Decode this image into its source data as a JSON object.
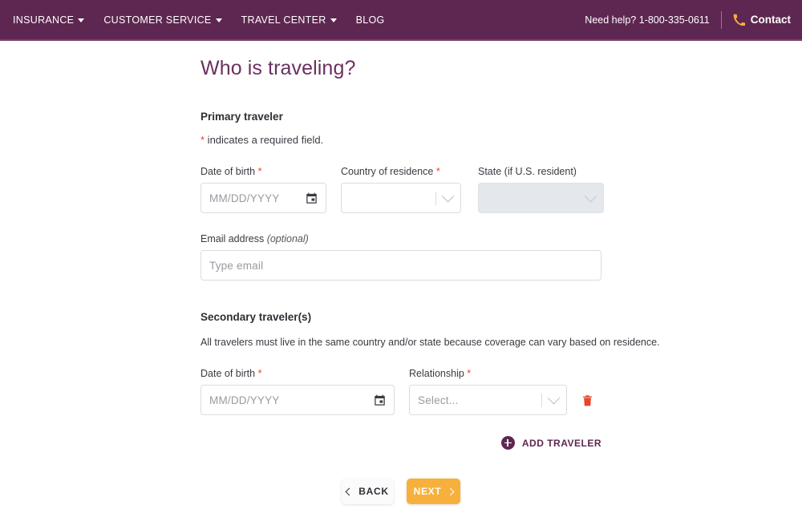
{
  "header": {
    "nav": [
      {
        "label": "INSURANCE",
        "has_caret": true,
        "icon": "chevron-down-icon"
      },
      {
        "label": "CUSTOMER SERVICE",
        "has_caret": true,
        "icon": "chevron-down-icon"
      },
      {
        "label": "TRAVEL CENTER",
        "has_caret": true,
        "icon": "chevron-down-icon"
      },
      {
        "label": "BLOG",
        "has_caret": false,
        "icon": ""
      }
    ],
    "help_text": "Need help? 1-800-335-0611",
    "contact_label": "Contact",
    "phone_icon": "phone-icon",
    "bg_color": "#5e2751",
    "accent_color": "#f7b03c"
  },
  "main": {
    "title": "Who is traveling?",
    "title_color": "#6b3060",
    "primary": {
      "heading": "Primary traveler",
      "required_note_asterisk": "*",
      "required_note": " indicates a required field.",
      "dob": {
        "label": "Date of birth",
        "required": "*",
        "placeholder": "MM/DD/YYYY",
        "value": "",
        "icon": "calendar-icon"
      },
      "country": {
        "label": "Country of residence",
        "required": "*",
        "placeholder": "",
        "value": "",
        "icon": "chevron-down-icon"
      },
      "state": {
        "label": "State (if U.S. resident)",
        "required": "",
        "placeholder": "",
        "value": "",
        "disabled": true,
        "icon": "chevron-down-icon"
      },
      "email": {
        "label": "Email address ",
        "optional_label": "(optional)",
        "placeholder": "Type email",
        "value": ""
      }
    },
    "secondary": {
      "heading": "Secondary traveler(s)",
      "description": "All travelers must live in the same country and/or state because coverage can vary based on residence.",
      "dob": {
        "label": "Date of birth",
        "required": "*",
        "placeholder": "MM/DD/YYYY",
        "value": "",
        "icon": "calendar-icon"
      },
      "relationship": {
        "label": "Relationship",
        "required": "*",
        "placeholder": "Select...",
        "value": "",
        "icon": "chevron-down-icon"
      },
      "delete_icon": "trash-icon",
      "delete_color": "#e8452c",
      "add_traveler_label": "ADD TRAVELER",
      "add_traveler_icon": "plus-circle-icon"
    },
    "footer": {
      "back_label": "BACK",
      "back_icon": "chevron-left-icon",
      "next_label": "NEXT",
      "next_icon": "chevron-right-icon",
      "next_color": "#f7b03c"
    }
  }
}
